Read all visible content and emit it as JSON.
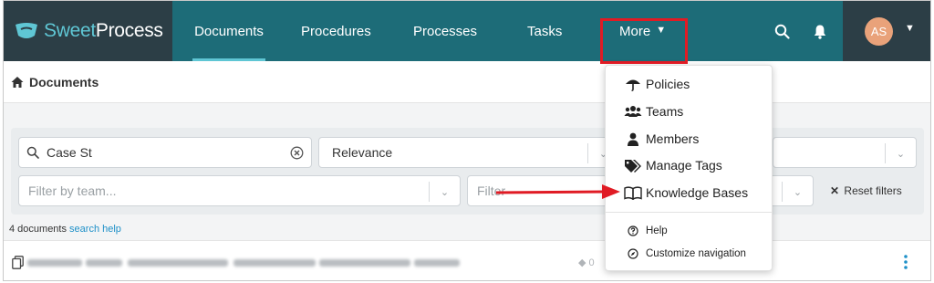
{
  "brand": {
    "name_part1": "Sweet",
    "name_part2": "Process",
    "accent_color": "#5fc6d4"
  },
  "nav": {
    "documents": "Documents",
    "procedures": "Procedures",
    "processes": "Processes",
    "tasks": "Tasks",
    "more": "More",
    "bar_color": "#1d6c78"
  },
  "user": {
    "initials": "AS"
  },
  "breadcrumb": {
    "label": "Documents",
    "icon": "home-icon"
  },
  "filters": {
    "search_value": "Case St",
    "sort_value": "Relevance",
    "team_placeholder": "Filter by team...",
    "filter_placeholder": "Filter",
    "reset_label": "Reset filters"
  },
  "results": {
    "count_text": "4 documents",
    "help_link": "search help",
    "tag_count": "0"
  },
  "more_menu": {
    "items": [
      {
        "label": "Policies",
        "icon": "umbrella-icon"
      },
      {
        "label": "Teams",
        "icon": "users-icon"
      },
      {
        "label": "Members",
        "icon": "user-icon"
      },
      {
        "label": "Manage Tags",
        "icon": "tags-icon"
      },
      {
        "label": "Knowledge Bases",
        "icon": "book-icon"
      }
    ],
    "secondary": [
      {
        "label": "Help",
        "icon": "question-icon"
      },
      {
        "label": "Customize navigation",
        "icon": "compass-icon"
      }
    ]
  },
  "annotation_color": "#e01b24"
}
